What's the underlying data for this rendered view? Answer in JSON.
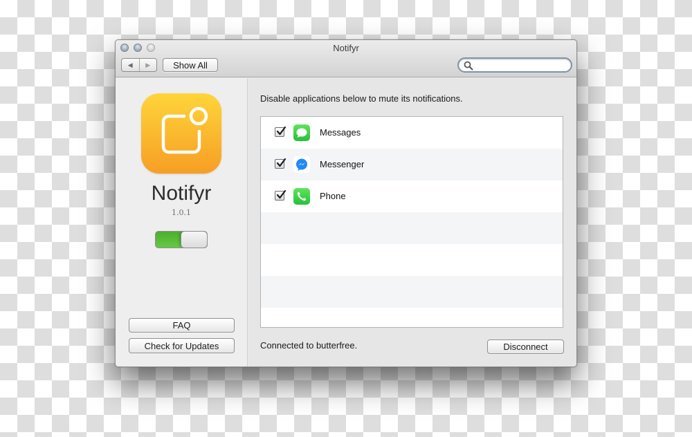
{
  "window": {
    "title": "Notifyr",
    "traffic_lights": [
      "close",
      "minimize",
      "zoom-disabled"
    ]
  },
  "toolbar": {
    "back_icon": "left-triangle-icon",
    "forward_icon": "right-triangle-icon",
    "back_glyph": "◀",
    "forward_glyph": "▶",
    "show_all_label": "Show All",
    "search": {
      "value": "",
      "placeholder": "",
      "icon": "search-icon"
    }
  },
  "sidebar": {
    "app_icon": "notification-badge-icon",
    "app_name": "Notifyr",
    "version": "1.0.1",
    "enabled_toggle": {
      "on": true
    },
    "faq_label": "FAQ",
    "check_updates_label": "Check for Updates"
  },
  "main": {
    "instruction": "Disable applications below to mute its notifications.",
    "apps": [
      {
        "name": "Messages",
        "checked": true,
        "icon": "messages-icon",
        "icon_color": "#3ad14b"
      },
      {
        "name": "Messenger",
        "checked": true,
        "icon": "messenger-icon",
        "icon_color": "#1e8bf5"
      },
      {
        "name": "Phone",
        "checked": true,
        "icon": "phone-icon",
        "icon_color": "#3ad14b"
      }
    ],
    "status": "Connected to butterfree.",
    "disconnect_label": "Disconnect"
  },
  "colors": {
    "app_icon_top": "#fed53a",
    "app_icon_bottom": "#f79e25",
    "toggle_on": "#58b938",
    "row_alt": "#f4f5f7"
  }
}
